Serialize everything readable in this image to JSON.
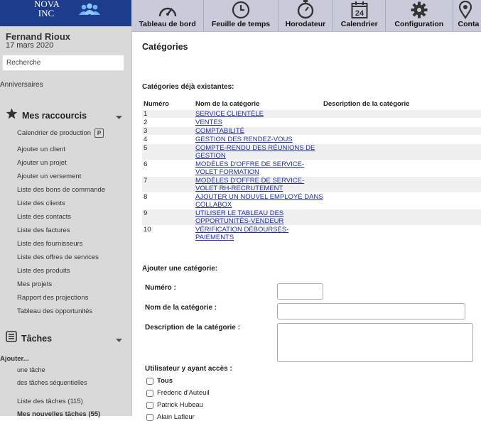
{
  "logo": {
    "brand_line1": "NOVA",
    "brand_line2": "INC"
  },
  "nav": [
    {
      "label": "Tableau de bord",
      "icon": "dashboard-icon"
    },
    {
      "label": "Feuille de temps",
      "icon": "clock-icon"
    },
    {
      "label": "Horodateur",
      "icon": "stopwatch-icon"
    },
    {
      "label": "Calendrier",
      "icon": "calendar-icon",
      "day": "24"
    },
    {
      "label": "Configuration",
      "icon": "gear-icon"
    },
    {
      "label": "Conta",
      "icon": "location-pin-icon"
    }
  ],
  "sidebar": {
    "user_name": "Fernand Rioux",
    "date": "17 mars 2020",
    "search_placeholder": "Recherche",
    "anniversaires": "Anniversaires",
    "shortcuts_title": "Mes raccourcis",
    "shortcuts": [
      "Calendrier de production",
      "Ajouter un client",
      "Ajouter un projet",
      "Ajouter un versement",
      "Liste des bons de commande",
      "Liste des clients",
      "Liste des contacts",
      "Liste des factures",
      "Liste des fournisseurs",
      "Liste des offres de services",
      "Liste des produits",
      "Mes projets",
      "Rapport des projections",
      "Tableau des opportunités"
    ],
    "production_badge": "P",
    "tasks_title": "Tâches",
    "tasks_add": "Ajouter...",
    "task_one": "une tâche",
    "task_seq": "des tâches séquentielles",
    "task_list": "Liste des tâches (115)",
    "task_new": "Mes nouvelles tâches (55)"
  },
  "main": {
    "title": "Catégories",
    "existing_title": "Catégories déjà existantes:",
    "headers": {
      "num": "Numéro",
      "name": "Nom de la catégorie",
      "desc": "Description de la catégorie"
    },
    "rows": [
      {
        "num": "1",
        "name": "Service clientèle",
        "desc": ""
      },
      {
        "num": "2",
        "name": "Ventes",
        "desc": ""
      },
      {
        "num": "3",
        "name": "Comptabilité",
        "desc": ""
      },
      {
        "num": "4",
        "name": "Gestion des rendez-vous",
        "desc": ""
      },
      {
        "num": "5",
        "name": "Compte-rendu des réunions de gestion",
        "desc": ""
      },
      {
        "num": "6",
        "name": "Modèles d'offre de service-volet formation",
        "desc": ""
      },
      {
        "num": "7",
        "name": "Modèles d'offre de service-volet RH-recrutement",
        "desc": ""
      },
      {
        "num": "8",
        "name": "Ajouter un nouvel employé dans Collabox",
        "desc": ""
      },
      {
        "num": "9",
        "name": "Utiliser le tableau des opportunités-vendeur",
        "desc": ""
      },
      {
        "num": "10",
        "name": "Vérification déboursés-paiements",
        "desc": ""
      }
    ],
    "add_title": "Ajouter une catégorie:",
    "form": {
      "num_label": "Numéro :",
      "name_label": "Nom de la catégorie :",
      "desc_label": "Description de la catégorie :",
      "access_label": "Utilisateur y ayant accès :",
      "num_value": "",
      "name_value": "",
      "desc_value": "",
      "users": [
        "Tous",
        "Fréderic d'Auteuil",
        "Patrick Hubeau",
        "Alain Lafleur"
      ]
    }
  }
}
